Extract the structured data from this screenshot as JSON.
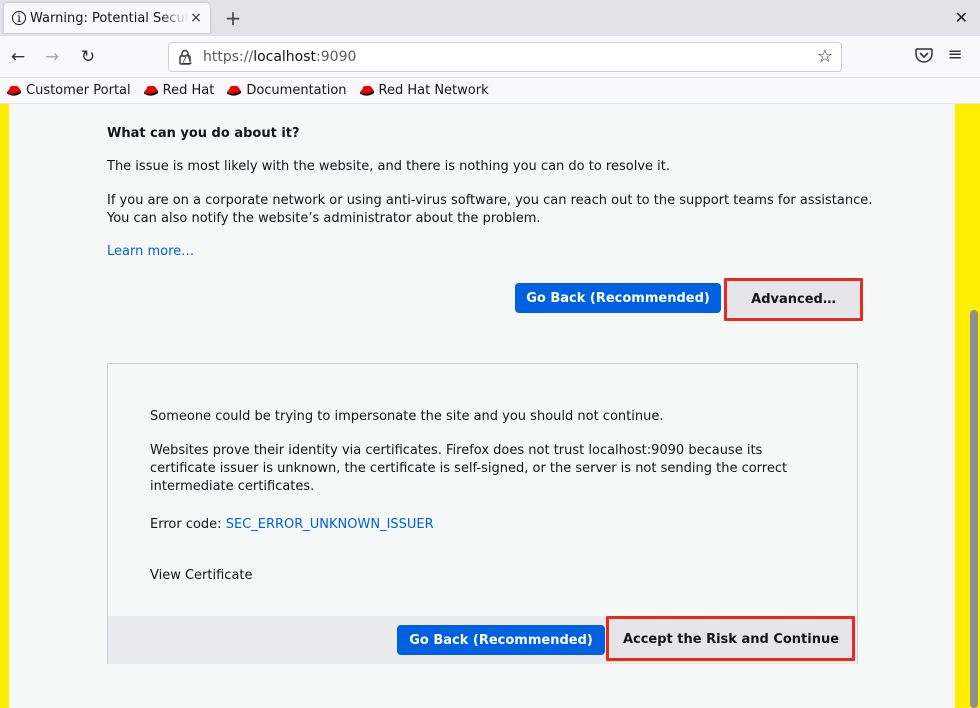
{
  "browser": {
    "tab_title": "Warning: Potential Security Risk Ahead",
    "tab_info_icon": "info-icon",
    "url_host": "https://",
    "url_domain": "localhost",
    "url_port": ":9090"
  },
  "bookmarks": [
    {
      "label": "Customer Portal",
      "icon": "redhat-icon"
    },
    {
      "label": "Red Hat",
      "icon": "redhat-icon"
    },
    {
      "label": "Documentation",
      "icon": "redhat-icon"
    },
    {
      "label": "Red Hat Network",
      "icon": "redhat-icon"
    }
  ],
  "warning": {
    "heading": "What can you do about it?",
    "p1": "The issue is most likely with the website, and there is nothing you can do to resolve it.",
    "p2_line1": "If you are on a corporate network or using anti-virus software, you can reach out to the support teams for assistance.",
    "p2_line2": "You can also notify the website’s administrator about the problem.",
    "learn_more": "Learn more…",
    "go_back": "Go Back (Recommended)",
    "advanced": "Advanced…"
  },
  "advanced": {
    "impersonate": "Someone could be trying to impersonate the site and you should not continue.",
    "cert_line1": "Websites prove their identity via certificates. Firefox does not trust localhost:9090 because its",
    "cert_line2": "certificate issuer is unknown, the certificate is self-signed, or the server is not sending the correct",
    "cert_line3": "intermediate certificates.",
    "error_label": "Error code: ",
    "error_code": "SEC_ERROR_UNKNOWN_ISSUER",
    "view_cert": "View Certificate",
    "go_back": "Go Back (Recommended)",
    "accept": "Accept the Risk and Continue"
  },
  "colors": {
    "accent": "#0061e0",
    "highlight": "#e8291c",
    "border_yellow": "#ffee00"
  }
}
